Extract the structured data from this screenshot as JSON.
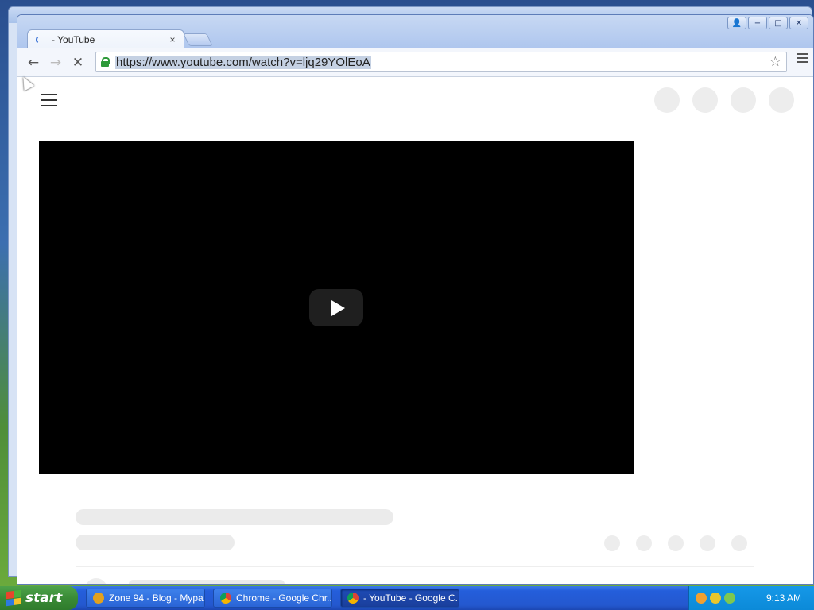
{
  "browser": {
    "tab": {
      "title": "- YouTube",
      "close": "×"
    },
    "toolbar": {
      "back": "←",
      "forward": "→",
      "stop": "✕",
      "url": "https://www.youtube.com/watch?v=ljq29YOlEoA",
      "star": "☆"
    },
    "window_controls": [
      "−",
      "□",
      "✕"
    ]
  },
  "page": {
    "loading": true,
    "icons": [
      "menu-icon",
      "play-icon"
    ]
  },
  "taskbar": {
    "start_label": "start",
    "tasks": [
      {
        "label": "Zone 94 - Blog - Mypal",
        "active": false
      },
      {
        "label": "Chrome - Google Chr...",
        "active": false
      },
      {
        "label": "- YouTube - Google C...",
        "active": true
      }
    ],
    "clock": "9:13 AM"
  },
  "colors": {
    "accent": "#245edb",
    "start": "#3a8b36",
    "lock": "#2e9a3a"
  }
}
